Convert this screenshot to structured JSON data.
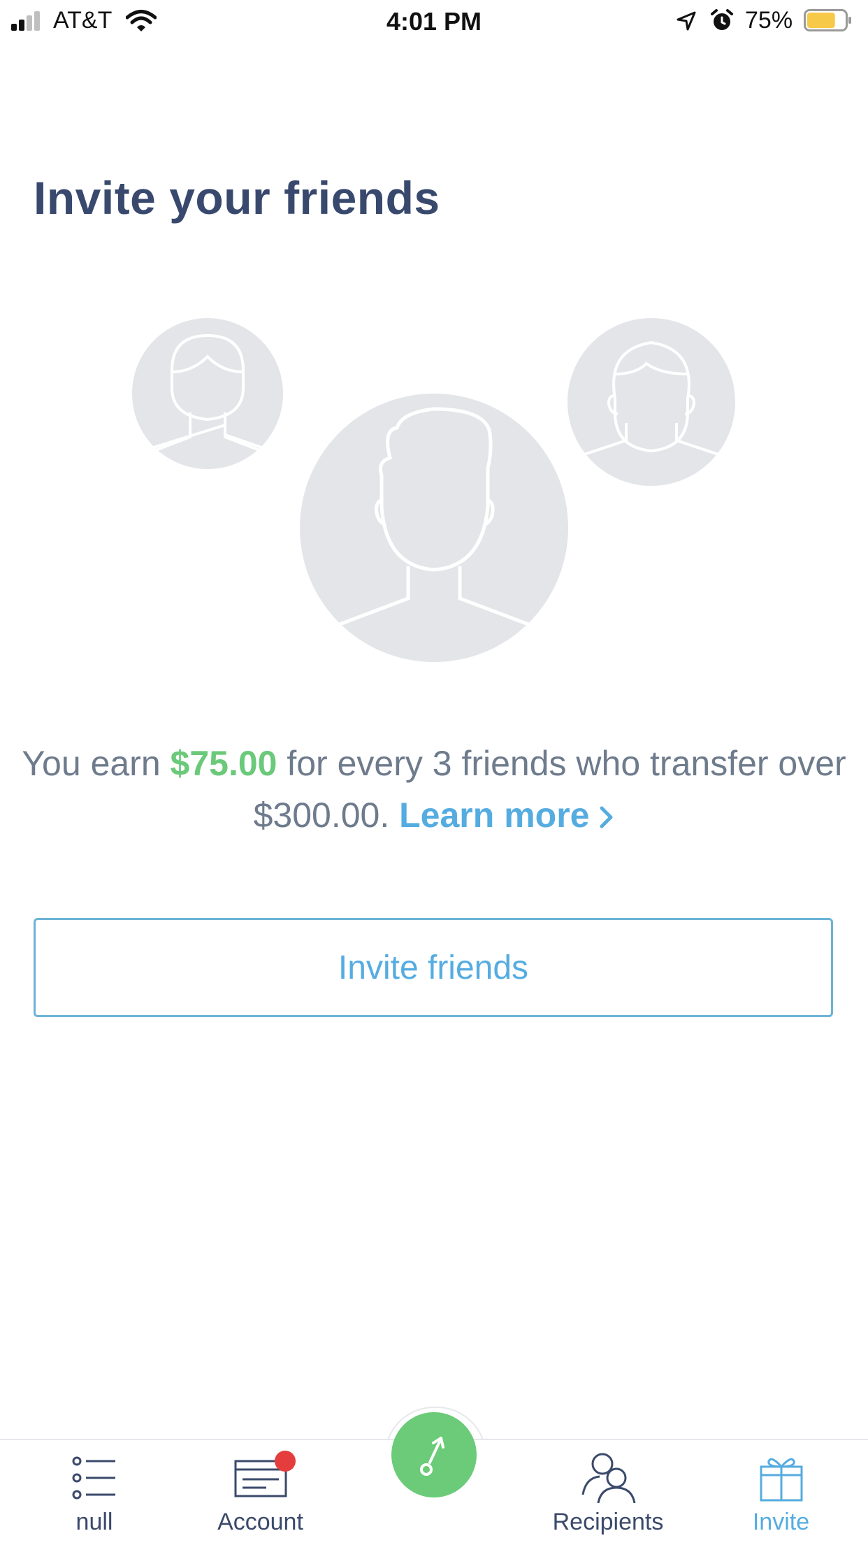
{
  "status_bar": {
    "carrier": "AT&T",
    "time": "4:01 PM",
    "battery_percent": "75%",
    "battery_level": 0.75,
    "battery_color": "#f7c948"
  },
  "page": {
    "title": "Invite your friends"
  },
  "illustration": {
    "icons": [
      "female-avatar-icon",
      "male-avatar-icon",
      "person-avatar-icon"
    ],
    "circle_color": "#e3e5e8"
  },
  "earn": {
    "prefix": "You earn ",
    "amount": "$75.00",
    "middle": " for every 3 friends who transfer over $300.00. ",
    "learn_more": "Learn more",
    "learn_more_icon": "chevron-right-icon"
  },
  "invite_button": {
    "label": "Invite friends"
  },
  "tabbar": {
    "tabs": [
      {
        "label": "null",
        "icon": "list-icon"
      },
      {
        "label": "Account",
        "icon": "card-icon"
      },
      {
        "label": "",
        "icon": "send-arrow-icon"
      },
      {
        "label": "Recipients",
        "icon": "recipients-icon"
      },
      {
        "label": "Invite",
        "icon": "gift-icon"
      }
    ],
    "active": "Invite",
    "accent_color": "#55ace0",
    "send_color": "#6bcb78",
    "badge_color": "#e53d3d"
  }
}
